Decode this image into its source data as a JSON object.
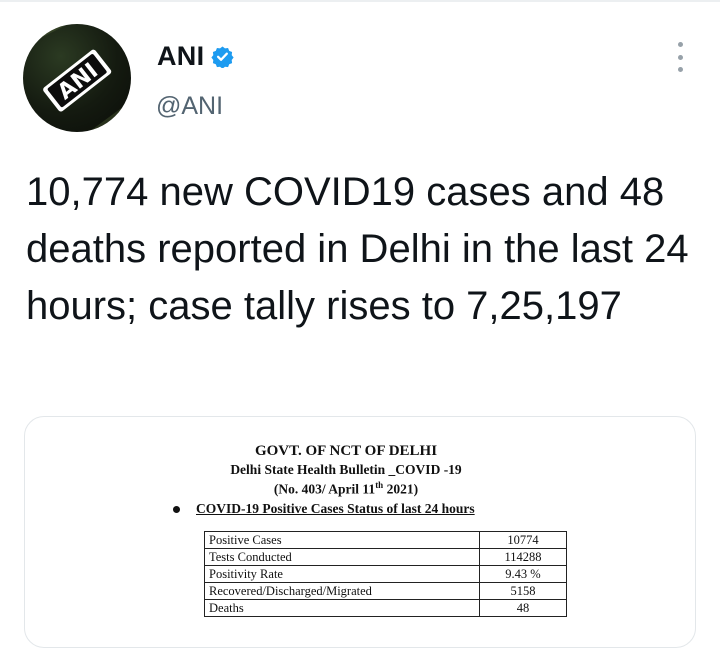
{
  "tweet": {
    "author_name": "ANI",
    "author_handle": "@ANI",
    "avatar_logo_text": "ANI",
    "text": "10,774 new COVID19 cases and 48 deaths reported in Delhi in the last 24 hours; case tally rises to 7,25,197",
    "icons": {
      "verified": "verified-badge-icon",
      "more": "more-options-icon"
    }
  },
  "bulletin": {
    "heading": "GOVT. OF NCT OF DELHI",
    "subheading": "Delhi State Health Bulletin _COVID -19",
    "number_prefix": "(No. 403/ April 11",
    "number_sup": "th",
    "number_suffix": " 2021)",
    "section_title": "COVID-19 Positive Cases Status of last 24 hours",
    "rows": [
      {
        "label": "Positive Cases",
        "value": "10774"
      },
      {
        "label": "Tests Conducted",
        "value": "114288"
      },
      {
        "label": "Positivity Rate",
        "value": "9.43 %"
      },
      {
        "label": "Recovered/Discharged/Migrated",
        "value": "5158"
      },
      {
        "label": "Deaths",
        "value": "48"
      }
    ]
  },
  "colors": {
    "verified_blue": "#1d9bf0",
    "handle_gray": "#536471",
    "text_dark": "#0f1419"
  }
}
